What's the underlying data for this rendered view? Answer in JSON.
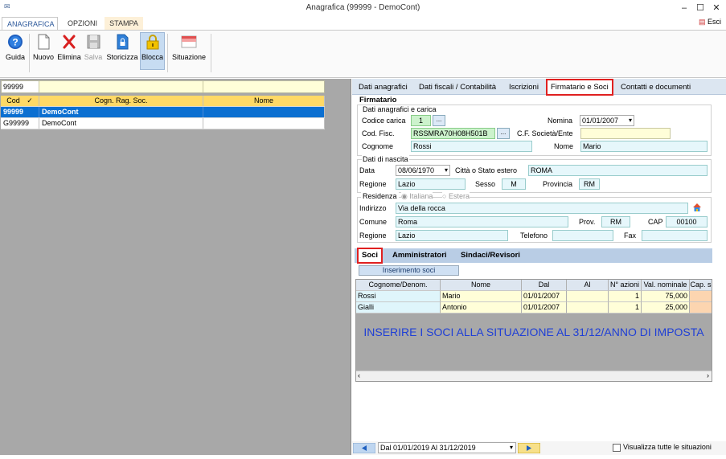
{
  "window": {
    "title": "Anagrafica (99999 - DemoCont)",
    "minimize": "–",
    "maximize": "☐",
    "close": "✕"
  },
  "ribbon": {
    "tabs": [
      "ANAGRAFICA",
      "OPZIONI",
      "STAMPA"
    ],
    "esci": "Esci",
    "buttons": [
      "Guida",
      "Nuovo",
      "Elimina",
      "Salva",
      "Storicizza",
      "Blocca",
      "Situazione"
    ]
  },
  "left": {
    "search_value": "99999",
    "headers": [
      "Cod",
      "Cogn. Rag. Soc.",
      "Nome"
    ],
    "sort_mark": "✓",
    "rows": [
      {
        "cod": "99999",
        "rag": "DemoCont",
        "nome": ""
      },
      {
        "cod": "G99999",
        "rag": "DemoCont",
        "nome": ""
      }
    ]
  },
  "right": {
    "tabs": [
      "Dati anagrafici",
      "Dati fiscali / Contabilità",
      "Iscrizioni",
      "Firmatario e Soci",
      "Contatti e documenti"
    ],
    "firmatario": {
      "title": "Firmatario",
      "group1": "Dati anagrafici e carica",
      "codice_carica_label": "Codice carica",
      "codice_carica": "1",
      "dots": "...",
      "nomina_label": "Nomina",
      "nomina": "01/01/2007",
      "cod_fisc_label": "Cod. Fisc.",
      "cod_fisc": "RSSMRA70H08H501B",
      "cf_societa_label": "C.F. Società/Ente",
      "cf_societa": "",
      "cognome_label": "Cognome",
      "cognome": "Rossi",
      "nome_label": "Nome",
      "nome": "Mario",
      "group2": "Dati di nascita",
      "data_label": "Data",
      "data": "08/06/1970",
      "citta_label": "Città o Stato estero",
      "citta": "ROMA",
      "regione_label": "Regione",
      "regione": "Lazio",
      "sesso_label": "Sesso",
      "sesso": "M",
      "provincia_label": "Provincia",
      "provincia": "RM",
      "residenza_label": "Residenza",
      "italiana": "Italiana",
      "estera": "Estera",
      "indirizzo_label": "Indirizzo",
      "indirizzo": "Via della rocca",
      "comune_label": "Comune",
      "comune": "Roma",
      "prov_label": "Prov.",
      "prov": "RM",
      "cap_label": "CAP",
      "cap": "00100",
      "regione2_label": "Regione",
      "regione2": "Lazio",
      "telefono_label": "Telefono",
      "telefono": "",
      "fax_label": "Fax",
      "fax": ""
    },
    "soci_tabs": [
      "Soci",
      "Amministratori",
      "Sindaci/Revisori"
    ],
    "inserimento": "Inserimento soci",
    "soci_headers": [
      "Cognome/Denom.",
      "Nome",
      "Dal",
      "Al",
      "N° azioni",
      "Val. nominale",
      "Cap. s"
    ],
    "soci_rows": [
      [
        "Rossi",
        "Mario",
        "01/01/2007",
        "",
        "1",
        "75,000",
        ""
      ],
      [
        "Gialli",
        "Antonio",
        "01/01/2007",
        "",
        "1",
        "25,000",
        ""
      ]
    ],
    "note": "INSERIRE I SOCI ALLA SITUAZIONE AL 31/12/ANNO DI IMPOSTA",
    "period": "Dal 01/01/2019 Al 31/12/2019",
    "checkbox_label": "Visualizza tutte le situazioni"
  }
}
